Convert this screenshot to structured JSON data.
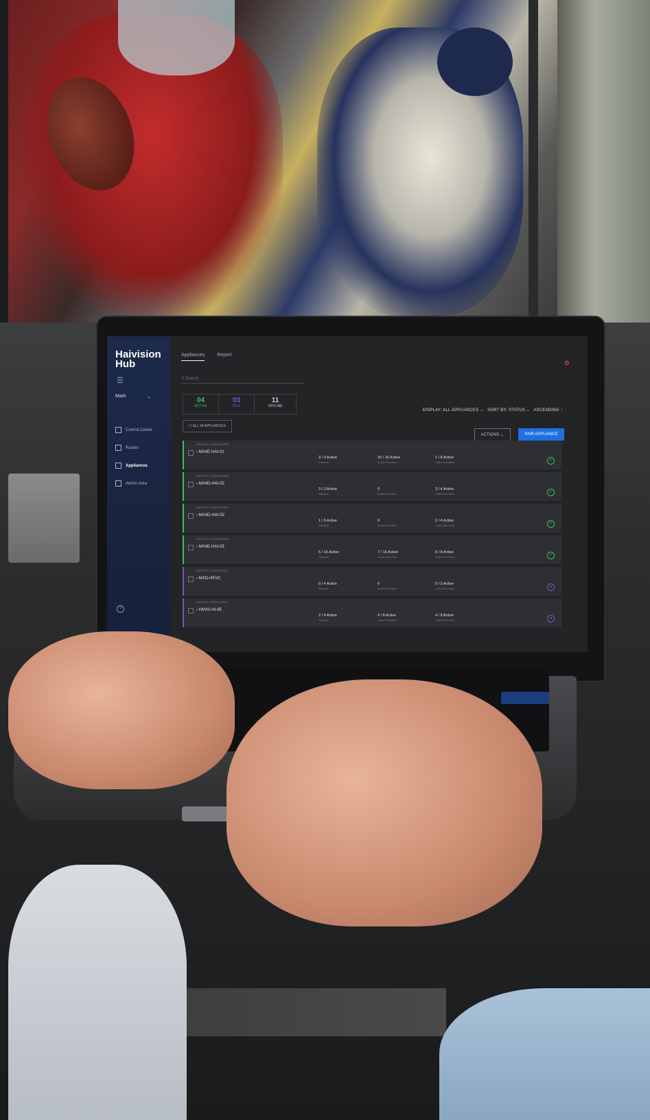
{
  "app": {
    "logo_line1": "Haivision",
    "logo_line2": "Hub",
    "user": "Mark",
    "nav": [
      {
        "label": "Control Center"
      },
      {
        "label": "Routes"
      },
      {
        "label": "Appliances"
      },
      {
        "label": "Admin Area"
      }
    ],
    "tabs": [
      {
        "label": "Appliances"
      },
      {
        "label": "Report"
      }
    ],
    "search_placeholder": "Search",
    "stats": [
      {
        "number": "04",
        "label": "ACTIVE",
        "color": "#3fbf5c"
      },
      {
        "number": "03",
        "label": "IDLE",
        "color": "#7a52c8"
      },
      {
        "number": "11",
        "label": "OFFLINE",
        "color": "#c8ccd4"
      }
    ],
    "display_label": "DISPLAY: ALL APPLIANCES",
    "sort_label": "SORT BY: STATUS",
    "order_label": "ASCENDING",
    "all_appliances_label": "ALL 18 APPLIANCES",
    "actions_label": "ACTIONS",
    "pair_label": "PAIR APPLIANCE",
    "rows": [
      {
        "type": "MAKITO X4 DECODER",
        "name": "MX4E-HAI-01",
        "c1": "3 / 3 Active",
        "c1s": "Streams",
        "c2": "16 / 16 Active",
        "c2s": "Audio Encoders",
        "c3": "1 / 8 Active",
        "c3s": "Video Encoders",
        "status": "active"
      },
      {
        "type": "MAKITO X4 DECODER",
        "name": "MX4D-HAI-02",
        "c1": "3 / 3 Active",
        "c1s": "Streams",
        "c2": "0",
        "c2s": "Audio Decoders",
        "c3": "3 / 4 Active",
        "c3s": "Video Decoders",
        "status": "active"
      },
      {
        "type": "MAKITO X4 DECODER",
        "name": "MX4D-HAI-02",
        "c1": "1 / 6 Active",
        "c1s": "Streams",
        "c2": "0",
        "c2s": "Audio Decoders",
        "c3": "2 / 4 Active",
        "c3s": "Video Decoders",
        "status": "active"
      },
      {
        "type": "MAKITO X4 ENCODER",
        "name": "MX4E-HAI-03",
        "c1": "5 / 16 Active",
        "c1s": "Streams",
        "c2": "7 / 16 Active",
        "c2s": "Audio Encoders",
        "c3": "5 / 8 Active",
        "c3s": "Video Encoders",
        "status": "active"
      },
      {
        "type": "MAKITO X ENCODER",
        "name": "MXD-HEVC",
        "c1": "0 / 4 Active",
        "c1s": "Streams",
        "c2": "0",
        "c2s": "Audio Decoders",
        "c3": "0 / 2 Active",
        "c3s": "Video Decoders",
        "status": "idle"
      },
      {
        "type": "MAKITO X ENCODER",
        "name": "HMX0-HI-65",
        "c1": "2 / 4 Active",
        "c1s": "Streams",
        "c2": "4 / 8 Active",
        "c2s": "Audio Encoders",
        "c3": "4 / 8 Active",
        "c3s": "Video Encoders",
        "status": "idle"
      }
    ]
  },
  "colors": {
    "active": "#3fbf5c",
    "idle": "#7a52c8",
    "accent": "#1f6fe0"
  }
}
